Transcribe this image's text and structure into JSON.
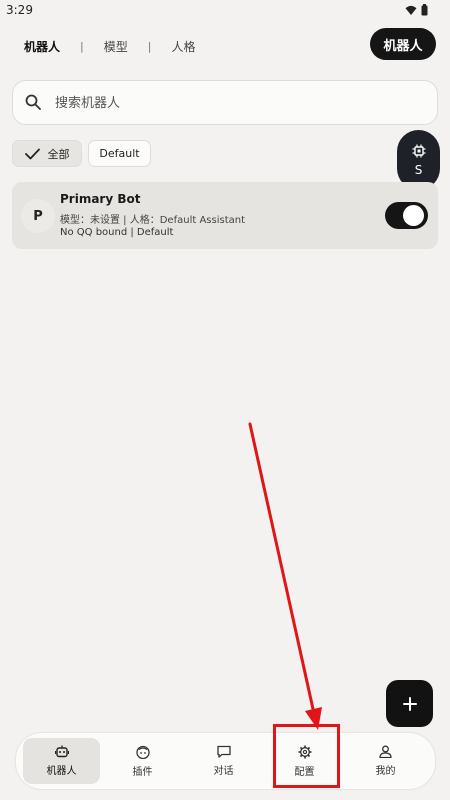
{
  "status_bar": {
    "time": "3:29",
    "wifi_icon": "wifi-icon",
    "battery_icon": "battery-icon"
  },
  "top_tabs": {
    "tab1": "机器人",
    "tab2": "模型",
    "tab3": "人格",
    "separator": "|"
  },
  "header_chip": {
    "label": "机器人"
  },
  "search": {
    "placeholder": "搜索机器人",
    "value": ""
  },
  "filters": {
    "all_label": "全部",
    "default_label": "Default"
  },
  "side_fab": {
    "label": "S",
    "icon": "chip-icon"
  },
  "bot_card": {
    "avatar_letter": "P",
    "name": "Primary Bot",
    "meta_line1": "模型：未设置 | 人格：Default Assistant",
    "meta_line2": "No QQ bound | Default",
    "enabled": true
  },
  "fab": {
    "icon": "plus-icon"
  },
  "bottom_nav": {
    "items": [
      {
        "label": "机器人",
        "icon": "robot-icon",
        "active": true
      },
      {
        "label": "插件",
        "icon": "plugin-icon",
        "active": false
      },
      {
        "label": "对话",
        "icon": "chat-icon",
        "active": false
      },
      {
        "label": "配置",
        "icon": "gear-icon",
        "active": false
      },
      {
        "label": "我的",
        "icon": "person-icon",
        "active": false
      }
    ]
  },
  "colors": {
    "accent": "#151515",
    "annotation": "#e01515",
    "background": "#f3f2f0"
  }
}
